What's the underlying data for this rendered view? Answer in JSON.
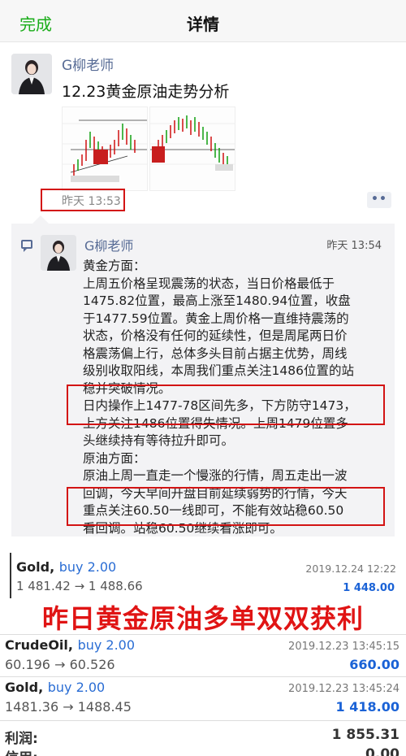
{
  "nav": {
    "done_label": "完成",
    "title": "详情"
  },
  "post": {
    "author": "G柳老师",
    "text": "12.23黄金原油走势分析",
    "time": "昨天 13:53",
    "more_label": "••",
    "images": [
      "gold-chart",
      "oil-chart"
    ]
  },
  "comment": {
    "author": "G柳老师",
    "time": "昨天 13:54",
    "lines": [
      "黄金方面：",
      "上周五价格呈现震荡的状态，当日价格最低于",
      "1475.82位置，最高上涨至1480.94位置，收盘",
      "于1477.59位置。黄金上周价格一直维持震荡的",
      "状态，价格没有任何的延续性，但是周尾两日价",
      "格震荡偏上行，总体多头目前占据主优势，周线",
      "级别收取阳线，本周我们重点关注1486位置的站",
      "稳并突破情况。",
      "日内操作上1477-78区间先多，下方防守1473，",
      "上方关注1486位置得失情况。上周1479位置多",
      "头继续持有等待拉升即可。",
      "原油方面：",
      "原油上周一直走一个慢涨的行情，周五走出一波",
      "回调，今天早间开盘目前延续弱势的行情，今天",
      "重点关注60.50一线即可，不能有效站稳60.50",
      "看回调。站稳60.50继续看涨即可。"
    ]
  },
  "trades": {
    "banner": "昨日黄金原油多单双双获利",
    "items": [
      {
        "symbol": "Gold",
        "side": "buy 2.00",
        "sep": ", ",
        "prices": "1 481.42 → 1 488.66",
        "date": "2019.12.24 12:22",
        "profit": "1 448.00"
      },
      {
        "symbol": "CrudeOil",
        "side": "buy 2.00",
        "sep": ", ",
        "prices": "60.196 → 60.526",
        "date": "2019.12.23 13:45:15",
        "profit": "660.00"
      },
      {
        "symbol": "Gold",
        "side": "buy 2.00",
        "sep": ", ",
        "prices": "1481.36 → 1488.45",
        "date": "2019.12.23 13:45:24",
        "profit": "1 418.00"
      }
    ],
    "profit_label": "利润:",
    "profit_total": "1 855.31",
    "credit_label": "信用:",
    "credit_value": "0.00"
  },
  "colors": {
    "link_blue": "#576b95",
    "accent_green": "#1aad19",
    "highlight_red": "#d31414",
    "profit_blue": "#1a62d6"
  }
}
